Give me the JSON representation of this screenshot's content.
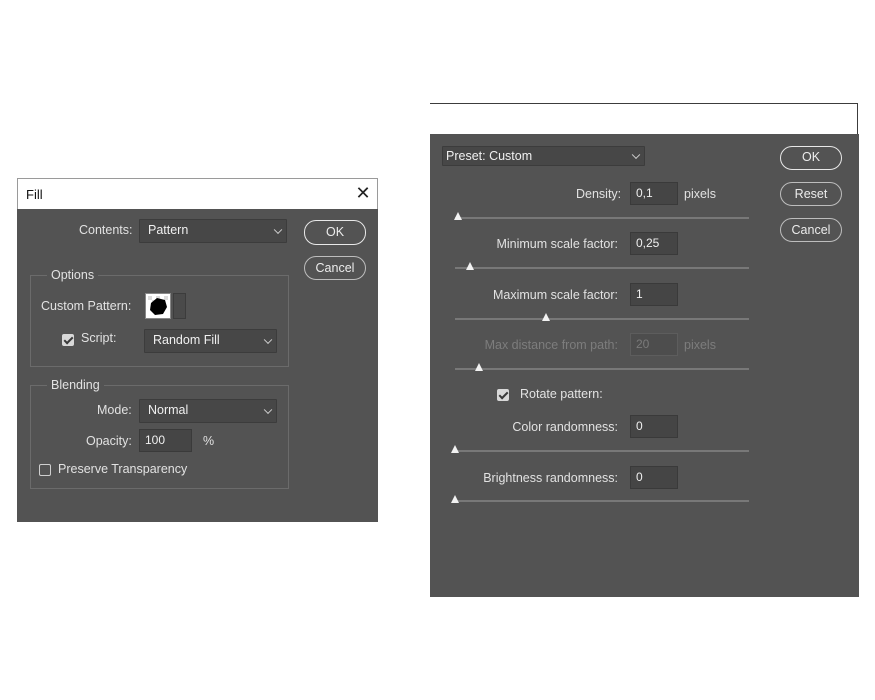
{
  "fill_dialog": {
    "title": "Fill",
    "close_icon": "close-icon",
    "contents_label": "Contents:",
    "contents_value": "Pattern",
    "ok_label": "OK",
    "cancel_label": "Cancel",
    "options": {
      "legend": "Options",
      "custom_pattern_label": "Custom Pattern:",
      "script_label": "Script:",
      "script_checked": true,
      "script_value": "Random Fill"
    },
    "blending": {
      "legend": "Blending",
      "mode_label": "Mode:",
      "mode_value": "Normal",
      "opacity_label": "Opacity:",
      "opacity_value": "100",
      "opacity_unit": "%",
      "preserve_label": "Preserve Transparency",
      "preserve_checked": false
    }
  },
  "random_fill_dialog": {
    "preset_value": "Preset: Custom",
    "ok_label": "OK",
    "reset_label": "Reset",
    "cancel_label": "Cancel",
    "density": {
      "label": "Density:",
      "value": "0,1",
      "unit": "pixels",
      "slider_fraction": 0.01
    },
    "min_scale": {
      "label": "Minimum scale factor:",
      "value": "0,25",
      "slider_fraction": 0.05
    },
    "max_scale": {
      "label": "Maximum scale factor:",
      "value": "1",
      "slider_fraction": 0.31
    },
    "max_distance": {
      "label": "Max distance from path:",
      "value": "20",
      "unit": "pixels",
      "slider_fraction": 0.08,
      "disabled": true
    },
    "rotate": {
      "label": "Rotate pattern:",
      "checked": true
    },
    "color_randomness": {
      "label": "Color randomness:",
      "value": "0",
      "slider_fraction": 0.0
    },
    "brightness_randomness": {
      "label": "Brightness randomness:",
      "value": "0",
      "slider_fraction": 0.0
    }
  }
}
